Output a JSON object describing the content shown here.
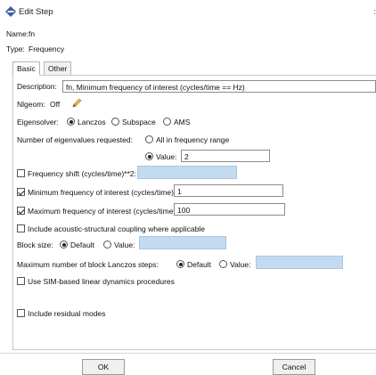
{
  "window": {
    "title": "Edit Step",
    "close_glyph": ":"
  },
  "meta": {
    "name_label": "Name:",
    "name_value": "fn",
    "type_label": "Type:",
    "type_value": "Frequency"
  },
  "tabs": [
    {
      "label": "Basic"
    },
    {
      "label": "Other"
    }
  ],
  "description": {
    "label": "Description:",
    "value": "fn, Minimum frequency of interest (cycles/time == Hz)"
  },
  "nlgeom": {
    "label": "Nlgeom:",
    "value": "Off"
  },
  "eigensolver": {
    "label": "Eigensolver:",
    "options": [
      "Lanczos",
      "Subspace",
      "AMS"
    ],
    "selected": "Lanczos"
  },
  "num_eigen": {
    "label": "Number of eigenvalues requested:",
    "all_label": "All in frequency range",
    "value_label": "Value:",
    "value": "2"
  },
  "freq_shift": {
    "label": "Frequency shift (cycles/time)**2:",
    "checked": false,
    "value": ""
  },
  "min_freq": {
    "label": "Minimum frequency of interest (cycles/time):",
    "checked": true,
    "value": "1"
  },
  "max_freq": {
    "label": "Maximum frequency of interest (cycles/time):",
    "checked": true,
    "value": "100"
  },
  "acoustic": {
    "label": "Include acoustic-structural coupling where applicable",
    "checked": false
  },
  "block_size": {
    "label": "Block size:",
    "default_label": "Default",
    "value_label": "Value:",
    "value": ""
  },
  "block_steps": {
    "label": "Maximum number of block Lanczos steps:",
    "default_label": "Default",
    "value_label": "Value:",
    "value": ""
  },
  "sim_based": {
    "label": "Use SIM-based linear dynamics procedures",
    "checked": false
  },
  "residual": {
    "label": "Include residual modes",
    "checked": false
  },
  "buttons": {
    "ok": "OK",
    "cancel": "Cancel"
  },
  "colors": {
    "highlight_field": "#c4daf1",
    "title_icon": "#3f5f9c"
  }
}
